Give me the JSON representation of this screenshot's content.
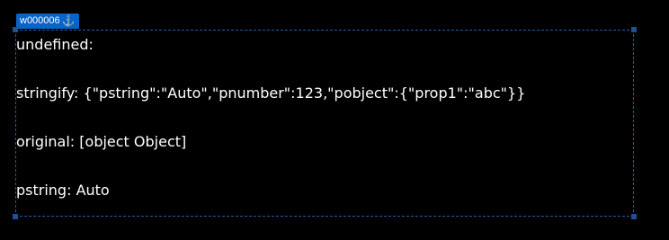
{
  "widget": {
    "id_label": "w000006",
    "anchor_icon": "anchor-icon",
    "accent_color": "#0b63c5"
  },
  "content": {
    "undefined_line": "undefined:",
    "stringify_line": "stringify: {\"pstring\":\"Auto\",\"pnumber\":123,\"pobject\":{\"prop1\":\"abc\"}}",
    "original_line": "original: [object Object]",
    "pstring_line": "pstring: Auto"
  }
}
